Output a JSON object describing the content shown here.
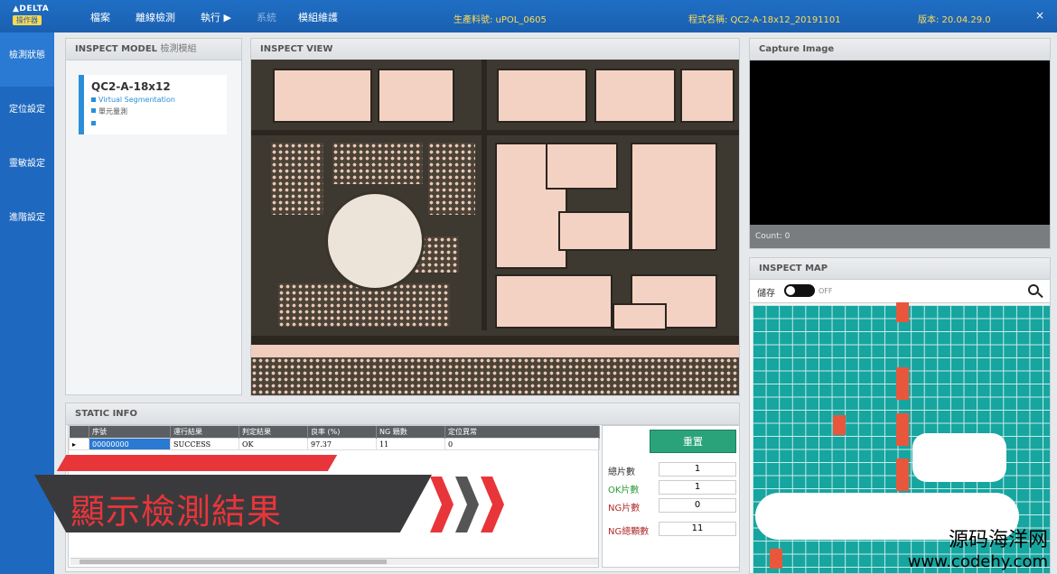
{
  "topbar": {
    "logo_brand": "▲DELTA",
    "logo_button": "操作器",
    "menu": [
      "檔案",
      "離線檢測",
      "執行 ▶",
      "系統",
      "模組維護"
    ],
    "product_label": "生產料號: uPOL_0605",
    "program_label": "程式名稱: QC2-A-18x12_20191101",
    "version_label": "版本: 20.04.29.0",
    "close": "×"
  },
  "sidebar": {
    "items": [
      {
        "label": "檢測狀態",
        "active": true
      },
      {
        "label": "定位設定",
        "active": false
      },
      {
        "label": "靈敏設定",
        "active": false
      },
      {
        "label": "進階設定",
        "active": false
      }
    ]
  },
  "inspect_model": {
    "title": "INSPECT MODEL",
    "title_cn": "檢測模組",
    "card_title": "QC2-A-18x12",
    "card_items": [
      "Virtual Segmentation",
      "單元量測",
      ""
    ]
  },
  "inspect_view": {
    "title": "INSPECT VIEW"
  },
  "capture": {
    "title": "Capture Image",
    "count_label": "Count: 0"
  },
  "inspect_map": {
    "title": "INSPECT MAP",
    "save_label": "儲存",
    "toggle_state": "OFF",
    "grid_color": "#17a5a0",
    "ng_color": "#e8573c"
  },
  "static_info": {
    "title": "STATIC INFO",
    "columns": [
      "序號",
      "運行結果",
      "判定結果",
      "良率 (%)",
      "NG 顆數",
      "定位異常"
    ],
    "rows": [
      [
        "00000000",
        "SUCCESS",
        "OK",
        "97.37",
        "11",
        "0"
      ]
    ],
    "reset_label": "重置",
    "stats": [
      {
        "label": "總片數",
        "value": "1",
        "color": "#333"
      },
      {
        "label": "OK片數",
        "value": "1",
        "color": "#2a9a3a"
      },
      {
        "label": "NG片數",
        "value": "0",
        "color": "#b02a2a"
      },
      {
        "label": "NG總顆數",
        "value": "11",
        "color": "#b02a2a"
      }
    ]
  },
  "overlay": {
    "caption": "顯示檢測結果"
  },
  "watermark": {
    "cn": "源码海洋网",
    "en": "www.codehy.com"
  }
}
